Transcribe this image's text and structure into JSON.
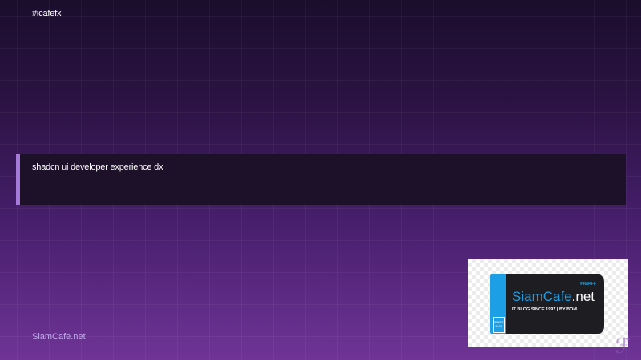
{
  "header": {
    "hashtag": "#icafefx"
  },
  "banner": {
    "text": "shadcn ui developer experience dx",
    "accent_color": "#a57ad9"
  },
  "footer": {
    "brand": "SiamCafe.net"
  },
  "logo": {
    "brand_part": "SiamCafe",
    "domain_part": ".net",
    "tagline": "IT BLOG SINCE 1997 | BY BOM",
    "hex_code": "#4694FF",
    "ribbon_text": "SINCE 1997",
    "brand_color": "#1d9fe6"
  },
  "corner_mark": {
    "icon": "script-logo-mark",
    "glyph": "ℱ"
  },
  "theme": {
    "background_top": "#1b0d2c",
    "background_bottom": "#6f3496"
  }
}
